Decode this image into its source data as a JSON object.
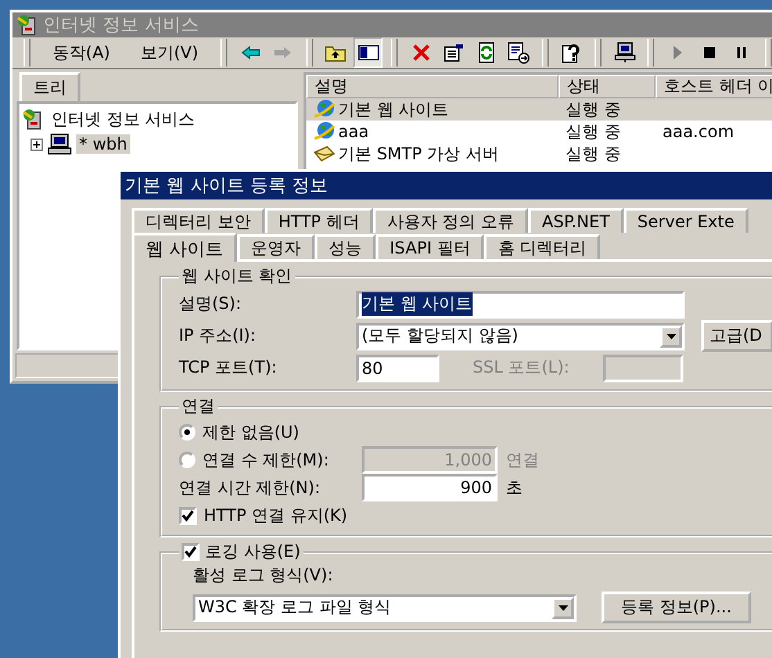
{
  "main_window": {
    "title": "인터넷 정보 서비스",
    "menu": [
      "동작(A)",
      "보기(V)"
    ],
    "show_tree_pressed": true,
    "tree_tab": "트리",
    "tree": [
      {
        "label": "인터넷 정보 서비스",
        "selected": false,
        "children": [
          {
            "label": "* wbh",
            "selected": true,
            "expanded": false
          }
        ]
      }
    ],
    "list": {
      "columns": [
        "설명",
        "상태",
        "호스트 헤더 이"
      ],
      "rows": [
        {
          "kind": "web",
          "name": "기본 웹 사이트",
          "status": "실행 중",
          "selected": true
        },
        {
          "kind": "web",
          "name": "aaa",
          "status": "실행 중",
          "host": "aaa.com",
          "selected": false
        },
        {
          "kind": "smtp",
          "name": "기본 SMTP 가상 서버",
          "status": "실행 중",
          "selected": false
        }
      ]
    }
  },
  "dialog": {
    "title": "기본 웹 사이트 등록 정보",
    "tabs_back": [
      {
        "label": "디렉터리 보안",
        "selected": false
      },
      {
        "label": "HTTP 헤더",
        "selected": false
      },
      {
        "label": "사용자 정의 오류",
        "selected": false
      },
      {
        "label": "ASP.NET",
        "selected": false
      },
      {
        "label": "Server Exte",
        "selected": false
      }
    ],
    "tabs_front": [
      {
        "label": "웹 사이트",
        "selected": true
      },
      {
        "label": "운영자",
        "selected": false
      },
      {
        "label": "성능",
        "selected": false
      },
      {
        "label": "ISAPI 필터",
        "selected": false
      },
      {
        "label": "홈 디렉터리",
        "selected": false
      }
    ],
    "identification": {
      "legend": "웹 사이트 확인",
      "description_label": "설명(S):",
      "description": "기본 웹 사이트",
      "ip_label": "IP 주소(I):",
      "ip": "(모두 할당되지 않음)",
      "advanced_button": "고급(D",
      "tcp_label": "TCP 포트(T):",
      "tcp": "80",
      "ssl_label": "SSL 포트(L):",
      "ssl_disabled": true
    },
    "connections": {
      "legend": "연결",
      "options": [
        {
          "label": "제한 없음(U)",
          "selected": true
        },
        {
          "label": "연결 수 제한(M):",
          "selected": false
        }
      ],
      "limit_value": "1,000",
      "limit_unit": "연결",
      "timeout_label": "연결 시간 제한(N):",
      "timeout": "900",
      "timeout_unit": "초",
      "keepalive": {
        "label": "HTTP 연결 유지(K)",
        "checked": true
      }
    },
    "logging": {
      "label": "로깅 사용(E)",
      "checked": true,
      "format_label": "활성 로그 형식(V):",
      "format": "W3C 확장 로그 파일 형식",
      "properties_button": "등록 정보(P)..."
    }
  }
}
